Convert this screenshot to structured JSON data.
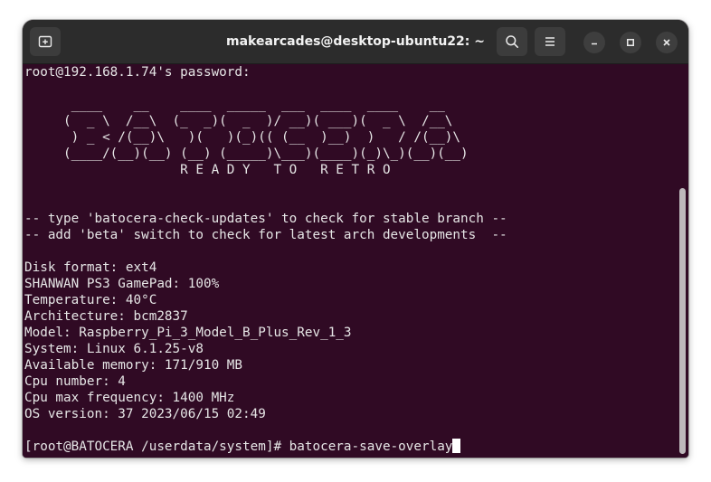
{
  "window": {
    "title": "makearcades@desktop-ubuntu22: ~"
  },
  "terminal": {
    "lines": [
      "root@192.168.1.74's password: ",
      "",
      "      ____    __    ____  _____  ___  ____  ____    __",
      "     (  _ \\  /__\\  (_  _)(  _  )/ __)( ___)(  _ \\  /__\\",
      "      ) _ < /(__)\\   )(   )(_)(( (__  )__)  )   / /(__)\\",
      "     (____/(__)(__) (__) (_____)\\___)(____)(_)\\_)(__)(__)",
      "                    R E A D Y   T O   R E T R O",
      "",
      "",
      "-- type 'batocera-check-updates' to check for stable branch --",
      "-- add 'beta' switch to check for latest arch developments  --",
      "",
      "Disk format: ext4",
      "SHANWAN PS3 GamePad: 100%",
      "Temperature: 40°C",
      "Architecture: bcm2837",
      "Model: Raspberry_Pi_3_Model_B_Plus_Rev_1_3",
      "System: Linux 6.1.25-v8",
      "Available memory: 171/910 MB",
      "Cpu number: 4",
      "Cpu max frequency: 1400 MHz",
      "OS version: 37 2023/06/15 02:49",
      "",
      "[root@BATOCERA /userdata/system]# batocera-save-overlay"
    ]
  },
  "colors": {
    "terminal_bg": "#300a24",
    "titlebar_bg": "#2c2c2c",
    "text": "#e6e6e6"
  },
  "icons": {
    "new_tab": "new-tab-icon",
    "search": "search-icon",
    "menu": "hamburger-menu-icon",
    "minimize": "minimize-icon",
    "maximize": "maximize-icon",
    "close": "close-icon"
  }
}
